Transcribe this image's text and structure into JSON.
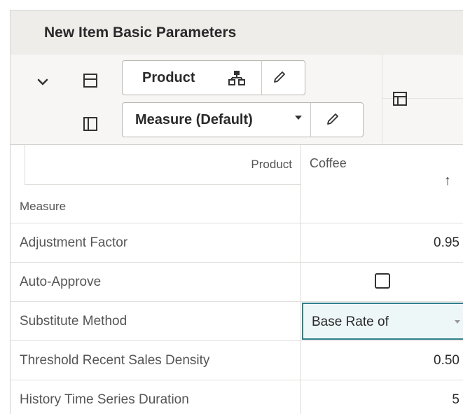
{
  "title": "New Item Basic Parameters",
  "toolbar": {
    "row_edge_label": "Product",
    "column_edge_label": "Measure (Default)"
  },
  "grid": {
    "corner": {
      "product_label": "Product",
      "measure_label": "Measure"
    },
    "column_header": "Coffee",
    "sort_indicator": "↑",
    "rows": [
      {
        "label": "Adjustment Factor",
        "value": "0.95"
      },
      {
        "label": "Auto-Approve",
        "value": ""
      },
      {
        "label": "Substitute Method",
        "value": "Base Rate of"
      },
      {
        "label": "Threshold Recent Sales Density",
        "value": "0.50"
      },
      {
        "label": "History Time Series Duration",
        "value": "5"
      }
    ]
  },
  "colors": {
    "accent": "#2f7f8a",
    "header_bg": "#eeedea"
  }
}
